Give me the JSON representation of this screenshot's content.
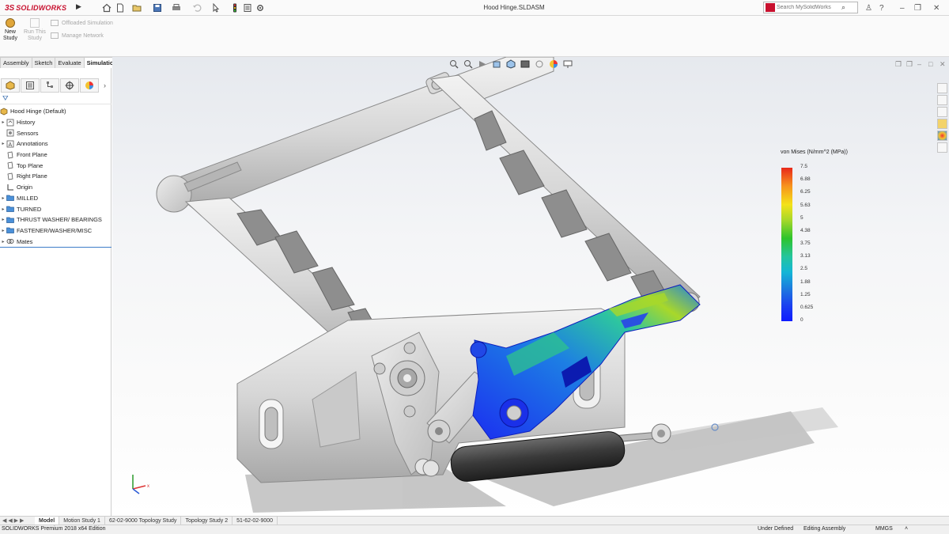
{
  "app": {
    "brand_ds": "3S",
    "brand_name": "SOLIDWORKS",
    "document_title": "Hood Hinge.SLDASM"
  },
  "search": {
    "placeholder": "Search MySolidWorks"
  },
  "command_manager": {
    "new_study": "New Study",
    "run_study": "Run This Study",
    "offloaded_simulation": "Offloaded Simulation",
    "manage_network": "Manage Network"
  },
  "tabs": [
    "Assembly",
    "Sketch",
    "Evaluate",
    "Simulation"
  ],
  "active_tab": "Simulation",
  "tree": {
    "root": "Hood Hinge  (Default)",
    "items": [
      {
        "label": "History",
        "expandable": true,
        "icon": "history-icon"
      },
      {
        "label": "Sensors",
        "expandable": false,
        "icon": "sensor-icon"
      },
      {
        "label": "Annotations",
        "expandable": true,
        "icon": "annotation-icon"
      },
      {
        "label": "Front Plane",
        "expandable": false,
        "icon": "plane-icon"
      },
      {
        "label": "Top Plane",
        "expandable": false,
        "icon": "plane-icon"
      },
      {
        "label": "Right Plane",
        "expandable": false,
        "icon": "plane-icon"
      },
      {
        "label": "Origin",
        "expandable": false,
        "icon": "origin-icon"
      },
      {
        "label": "MILLED",
        "expandable": true,
        "icon": "folder-icon"
      },
      {
        "label": "TURNED",
        "expandable": true,
        "icon": "folder-icon"
      },
      {
        "label": "THRUST WASHER/ BEARINGS",
        "expandable": true,
        "icon": "folder-icon"
      },
      {
        "label": "FASTENER/WASHER/MISC",
        "expandable": true,
        "icon": "folder-icon"
      },
      {
        "label": "Mates",
        "expandable": true,
        "icon": "mates-icon"
      }
    ]
  },
  "legend": {
    "title": "von Mises (N/mm^2 (MPa))",
    "values": [
      "7.5",
      "6.88",
      "6.25",
      "5.63",
      "5",
      "4.38",
      "3.75",
      "3.13",
      "2.5",
      "1.88",
      "1.25",
      "0.625",
      "0"
    ]
  },
  "bottom_tabs": [
    "Model",
    "Motion Study 1",
    "62-02-9000 Topology Study",
    "Topology Study 2",
    "51-62-02-9000"
  ],
  "status": {
    "edition": "SOLIDWORKS Premium 2018 x64 Edition",
    "constraint": "Under Defined",
    "mode": "Editing Assembly",
    "units": "MMGS"
  },
  "colors": {
    "brand": "#c8102e",
    "selection": "#3d7cc9",
    "folder": "#4a90d9"
  }
}
